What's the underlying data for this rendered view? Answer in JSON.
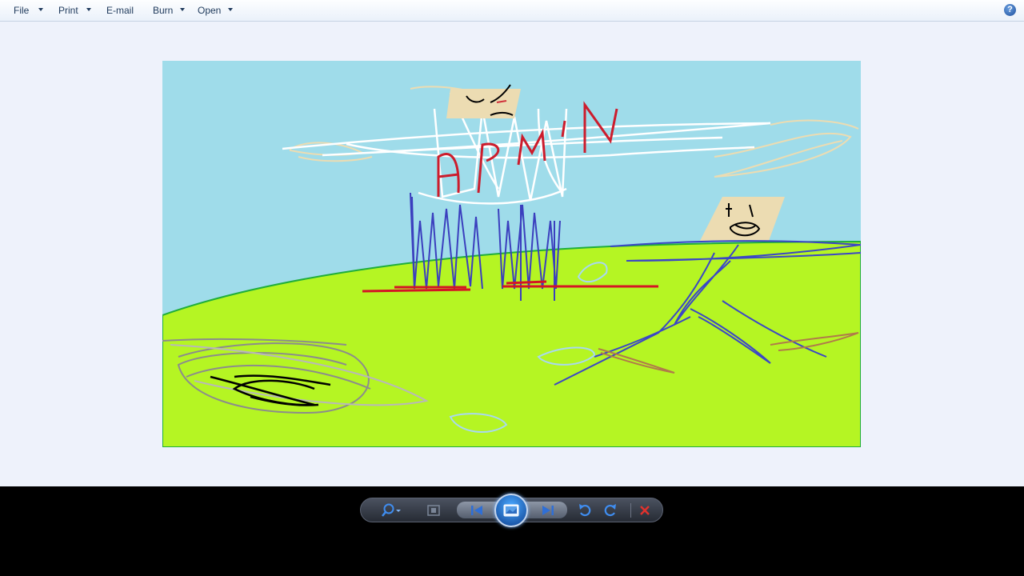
{
  "menu": {
    "file": "File",
    "print": "Print",
    "email": "E-mail",
    "burn": "Burn",
    "open": "Open",
    "help_glyph": "?"
  },
  "picture": {
    "drawn_word": "ADMIN"
  },
  "toolbar": {
    "icons": [
      "zoom-icon",
      "actual-size-icon",
      "previous-icon",
      "slideshow-icon",
      "next-icon",
      "rotate-left-icon",
      "rotate-right-icon",
      "delete-icon"
    ]
  },
  "colors": {
    "sky": "#9fdcea",
    "grass": "#b5f523",
    "viewer_bg": "#eef2fb",
    "accent_blue": "#2f6fd6",
    "delete_red": "#e0322d"
  }
}
